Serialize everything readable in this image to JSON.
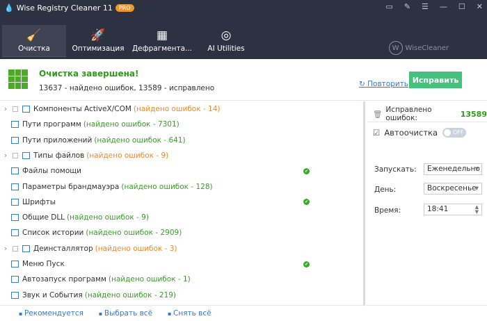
{
  "app": {
    "title": "Wise Registry Cleaner 11",
    "badge": "PRO",
    "brand": "WiseCleaner"
  },
  "nav": [
    {
      "label": "Очистка",
      "icon": "broom-icon"
    },
    {
      "label": "Оптимизация",
      "icon": "rocket-icon"
    },
    {
      "label": "Дефрагмента...",
      "icon": "grid-icon"
    },
    {
      "label": "AI Utilities",
      "icon": "ai-icon"
    }
  ],
  "header": {
    "title": "Очистка завершена!",
    "summary": "13637 - найдено ошибок, 13589 - исправлено",
    "retry": "Повторить",
    "fix": "Исправить"
  },
  "items": [
    {
      "label": "Компоненты ActiveX/COM",
      "count": "(найдено ошибок - 14)",
      "color": "orange",
      "expandable": true
    },
    {
      "label": "Пути программ",
      "count": "(найдено ошибок - 7301)",
      "color": "green"
    },
    {
      "label": "Пути приложений",
      "count": "(найдено ошибок - 641)",
      "color": "green"
    },
    {
      "label": "Типы файлов",
      "count": "(найдено ошибок - 9)",
      "color": "orange",
      "expandable": true
    },
    {
      "label": "Файлы помощи",
      "count": "",
      "ok": true
    },
    {
      "label": "Параметры брандмауэра",
      "count": "(найдено ошибок - 128)",
      "color": "green"
    },
    {
      "label": "Шрифты",
      "count": "",
      "ok": true
    },
    {
      "label": "Общие DLL",
      "count": "(найдено ошибок - 9)",
      "color": "green"
    },
    {
      "label": "Список истории",
      "count": "(найдено ошибок - 2909)",
      "color": "green"
    },
    {
      "label": "Деинсталлятор",
      "count": "(найдено ошибок - 3)",
      "color": "orange",
      "expandable": true
    },
    {
      "label": "Меню Пуск",
      "count": "",
      "ok": true
    },
    {
      "label": "Автозапуск программ",
      "count": "(найдено ошибок - 1)",
      "color": "green"
    },
    {
      "label": "Звук и События",
      "count": "(найдено ошибок - 219)",
      "color": "green"
    }
  ],
  "side": {
    "fixed_label": "Исправлено ошибок:",
    "fixed_value": "13589",
    "auto_label": "Автоочистка",
    "toggle": "OFF",
    "run_label": "Запускать:",
    "run_value": "Еженедельно",
    "day_label": "День:",
    "day_value": "Воскресенье",
    "time_label": "Время:",
    "time_value": "18:41"
  },
  "footer": {
    "recommended": "Рекомендуется",
    "select_all": "Выбрать всё",
    "deselect_all": "Снять всё"
  },
  "colors": {
    "nav_bg": "#2d3242",
    "green": "#3c9c2a",
    "orange": "#f0882a",
    "fix_button": "#46c17d",
    "link": "#3a78c8"
  }
}
